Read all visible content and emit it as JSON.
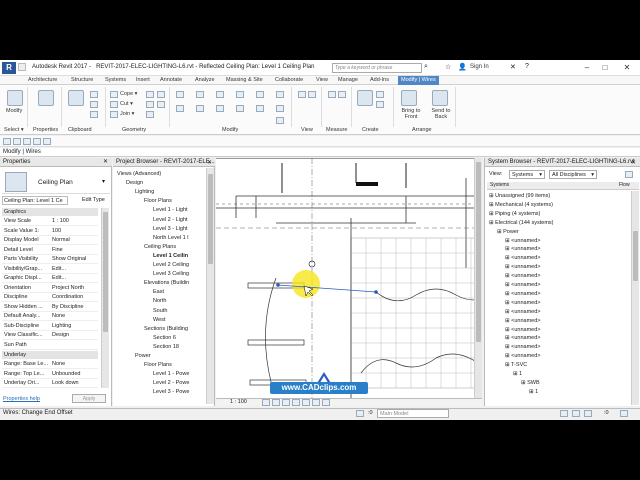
{
  "window": {
    "app_title": "Autodesk Revit 2017 -",
    "doc_title": "REVIT-2017-ELEC-LIGHTING-L6.rvt - Reflected Ceiling Plan: Level 1 Ceiling Plan",
    "search_placeholder": "Type a keyword or phrase",
    "sign_in": "Sign In"
  },
  "tabs": [
    "Architecture",
    "Structure",
    "Systems",
    "Insert",
    "Annotate",
    "Analyze",
    "Massing & Site",
    "Collaborate",
    "View",
    "Manage",
    "Add-Ins",
    "Modify | Wires"
  ],
  "ribbon": {
    "modify_label": "Modify",
    "select_label": "Select ▾",
    "properties_label": "Properties",
    "clipboard_label": "Clipboard",
    "geometry_label": "Geometry",
    "modify_panel_label": "Modify",
    "view_label": "View",
    "measure_label": "Measure",
    "create_label": "Create",
    "arrange_label": "Arrange",
    "cope": "Cope ▾",
    "cut": "Cut ▾",
    "join": "Join ▾",
    "bring_to_front": "Bring to Front",
    "send_to_back": "Send to Back"
  },
  "context_bar": "Modify | Wires",
  "properties": {
    "header": "Properties",
    "type_name": "Ceiling Plan",
    "selector": "Ceiling Plan: Level 1 Ce",
    "edit_type": "Edit Type",
    "sections": {
      "graphics": "Graphics",
      "underlay": "Underlay"
    },
    "rows": [
      {
        "k": "View Scale",
        "v": "1 : 100"
      },
      {
        "k": "Scale Value 1:",
        "v": "100"
      },
      {
        "k": "Display Model",
        "v": "Normal"
      },
      {
        "k": "Detail Level",
        "v": "Fine"
      },
      {
        "k": "Parts Visibility",
        "v": "Show Original"
      },
      {
        "k": "Visibility/Grap...",
        "v": "Edit..."
      },
      {
        "k": "Graphic Displ...",
        "v": "Edit..."
      },
      {
        "k": "Orientation",
        "v": "Project North"
      },
      {
        "k": "Discipline",
        "v": "Coordination"
      },
      {
        "k": "Show Hidden ...",
        "v": "By Discipline"
      },
      {
        "k": "Default Analy...",
        "v": "None"
      },
      {
        "k": "Sub-Discipline",
        "v": "Lighting"
      },
      {
        "k": "View Classific...",
        "v": "Design"
      },
      {
        "k": "Sun Path",
        "v": ""
      }
    ],
    "underlay_rows": [
      {
        "k": "Range: Base Le...",
        "v": "None"
      },
      {
        "k": "Range: Top Le...",
        "v": "Unbounded"
      },
      {
        "k": "Underlay Ori...",
        "v": "Look down"
      }
    ],
    "help": "Properties help",
    "apply": "Apply"
  },
  "project_browser": {
    "header": "Project Browser - REVIT-2017-ELE...",
    "nodes": [
      {
        "t": "Views (Advanced)",
        "d": 0
      },
      {
        "t": "Design",
        "d": 1
      },
      {
        "t": "Lighting",
        "d": 2
      },
      {
        "t": "Floor Plans",
        "d": 3
      },
      {
        "t": "Level 1 - Light",
        "d": 4
      },
      {
        "t": "Level 2 - Light",
        "d": 4
      },
      {
        "t": "Level 3 - Light",
        "d": 4
      },
      {
        "t": "North Level 1 l",
        "d": 4
      },
      {
        "t": "Ceiling Plans",
        "d": 3
      },
      {
        "t": "Level 1 Ceilin",
        "d": 4,
        "bold": true
      },
      {
        "t": "Level 2 Ceiling",
        "d": 4
      },
      {
        "t": "Level 3 Ceiling",
        "d": 4
      },
      {
        "t": "Elevations (Buildin",
        "d": 3
      },
      {
        "t": "East",
        "d": 4
      },
      {
        "t": "North",
        "d": 4
      },
      {
        "t": "South",
        "d": 4
      },
      {
        "t": "West",
        "d": 4
      },
      {
        "t": "Sections (Building",
        "d": 3
      },
      {
        "t": "Section 6",
        "d": 4
      },
      {
        "t": "Section 18",
        "d": 4
      },
      {
        "t": "Power",
        "d": 2
      },
      {
        "t": "Floor Plans",
        "d": 3
      },
      {
        "t": "Level 1 - Powe",
        "d": 4
      },
      {
        "t": "Level 2 - Powe",
        "d": 4
      },
      {
        "t": "Level 3 - Powe",
        "d": 4
      }
    ]
  },
  "system_browser": {
    "header": "System Browser - REVIT-2017-ELEC-LIGHTING-L6.rvt",
    "view_label": "View:",
    "view_value": "Systems",
    "discipline_value": "All Disciplines",
    "col_systems": "Systems",
    "col_flow": "Flow",
    "nodes": [
      {
        "t": "Unassigned (99 items)",
        "d": 0
      },
      {
        "t": "Mechanical (4 systems)",
        "d": 0
      },
      {
        "t": "Piping (4 systems)",
        "d": 0
      },
      {
        "t": "Electrical (144 systems)",
        "d": 0
      },
      {
        "t": "Power",
        "d": 1
      },
      {
        "t": "<unnamed>",
        "d": 2
      },
      {
        "t": "<unnamed>",
        "d": 2
      },
      {
        "t": "<unnamed>",
        "d": 2
      },
      {
        "t": "<unnamed>",
        "d": 2
      },
      {
        "t": "<unnamed>",
        "d": 2
      },
      {
        "t": "<unnamed>",
        "d": 2
      },
      {
        "t": "<unnamed>",
        "d": 2
      },
      {
        "t": "<unnamed>",
        "d": 2
      },
      {
        "t": "<unnamed>",
        "d": 2
      },
      {
        "t": "<unnamed>",
        "d": 2
      },
      {
        "t": "<unnamed>",
        "d": 2
      },
      {
        "t": "<unnamed>",
        "d": 2
      },
      {
        "t": "<unnamed>",
        "d": 2
      },
      {
        "t": "<unnamed>",
        "d": 2
      },
      {
        "t": "T-SVC",
        "d": 2
      },
      {
        "t": "1",
        "d": 3
      },
      {
        "t": "SWB",
        "d": 4
      },
      {
        "t": "1",
        "d": 5
      }
    ]
  },
  "view_control": {
    "scale": "1 : 100"
  },
  "status": {
    "left": "Wires: Change End Offset",
    "model": "Main Model",
    "filter_count": ":0"
  },
  "watermark": "www.CADclips.com"
}
